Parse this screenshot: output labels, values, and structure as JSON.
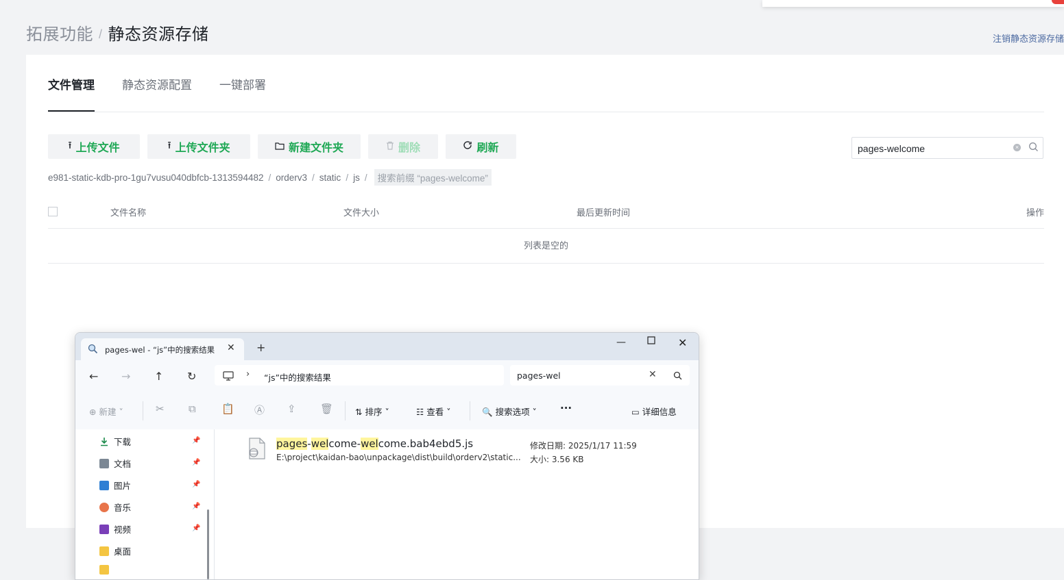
{
  "header": {
    "crumb_parent": "拓展功能",
    "crumb_sep": "/",
    "crumb_current": "静态资源存储",
    "logout_link": "注销静态资源存储"
  },
  "tabs": [
    {
      "label": "文件管理",
      "active": true
    },
    {
      "label": "静态资源配置",
      "active": false
    },
    {
      "label": "一键部署",
      "active": false
    }
  ],
  "toolbar": {
    "upload_file": "上传文件",
    "upload_folder": "上传文件夹",
    "new_folder": "新建文件夹",
    "delete": "删除",
    "refresh": "刷新"
  },
  "search": {
    "value": "pages-welcome"
  },
  "path": {
    "segments": [
      "e981-static-kdb-pro-1gu7vusu040dbfcb-1313594482",
      "orderv3",
      "static",
      "js"
    ],
    "search_tag": "搜索前缀 “pages-welcome”"
  },
  "table": {
    "columns": [
      "文件名称",
      "文件大小",
      "最后更新时间",
      "操作"
    ],
    "empty_text": "列表是空的"
  },
  "explorer": {
    "tab_title": "pages-wel - “js”中的搜索结果",
    "address": "“js”中的搜索结果",
    "search_value": "pages-wel",
    "toolbar": {
      "new": "新建",
      "sort": "排序",
      "view": "查看",
      "search_options": "搜索选项",
      "more": "···",
      "details": "详细信息"
    },
    "sidebar": [
      {
        "label": "下载",
        "icon": "download-icon",
        "pinned": true
      },
      {
        "label": "文档",
        "icon": "document-icon",
        "pinned": true
      },
      {
        "label": "图片",
        "icon": "picture-icon",
        "pinned": true
      },
      {
        "label": "音乐",
        "icon": "music-icon",
        "pinned": true
      },
      {
        "label": "视频",
        "icon": "video-icon",
        "pinned": true
      },
      {
        "label": "桌面",
        "icon": "folder-icon",
        "pinned": false
      }
    ],
    "result": {
      "name_parts": [
        "pages",
        "-",
        "wel",
        "come-",
        "wel",
        "come.bab4ebd5.js"
      ],
      "path": "E:\\project\\kaidan-bao\\unpackage\\dist\\build\\orderv2\\static...",
      "modified": "修改日期: 2025/1/17 11:59",
      "size": "大小: 3.56 KB"
    }
  },
  "colors": {
    "accent_green": "#1fa855",
    "highlight": "#fff59d"
  }
}
